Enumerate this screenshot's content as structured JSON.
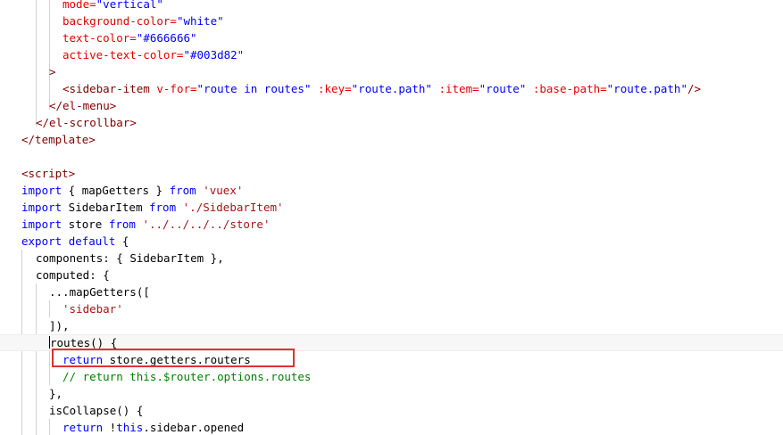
{
  "colors": {
    "tag": "#800000",
    "attribute": "#e50000",
    "string": "#0000ff",
    "keyword": "#0000ff",
    "js_string": "#a31515",
    "comment": "#008000",
    "plain": "#000000",
    "highlight_box": "#e03131"
  },
  "lines": [
    {
      "id": "l01",
      "tokens": [
        {
          "text": "mode=",
          "kind": "attribute"
        },
        {
          "text": "\"vertical\"",
          "kind": "string"
        }
      ]
    },
    {
      "id": "l02",
      "tokens": [
        {
          "text": "background-color=",
          "kind": "attribute"
        },
        {
          "text": "\"white\"",
          "kind": "string"
        }
      ]
    },
    {
      "id": "l03",
      "tokens": [
        {
          "text": "text-color=",
          "kind": "attribute"
        },
        {
          "text": "\"#666666\"",
          "kind": "string"
        }
      ]
    },
    {
      "id": "l04",
      "tokens": [
        {
          "text": "active-text-color=",
          "kind": "attribute"
        },
        {
          "text": "\"#003d82\"",
          "kind": "string"
        }
      ]
    },
    {
      "id": "l05",
      "tokens": [
        {
          "text": ">",
          "kind": "tag"
        }
      ]
    },
    {
      "id": "l06",
      "tokens": [
        {
          "text": "<sidebar-item",
          "kind": "tag"
        },
        {
          "text": " ",
          "kind": "plain"
        },
        {
          "text": "v-for=",
          "kind": "attribute"
        },
        {
          "text": "\"route in routes\"",
          "kind": "string"
        },
        {
          "text": " ",
          "kind": "plain"
        },
        {
          "text": ":key=",
          "kind": "attribute"
        },
        {
          "text": "\"route.path\"",
          "kind": "string"
        },
        {
          "text": " ",
          "kind": "plain"
        },
        {
          "text": ":item=",
          "kind": "attribute"
        },
        {
          "text": "\"route\"",
          "kind": "string"
        },
        {
          "text": " ",
          "kind": "plain"
        },
        {
          "text": ":base-path=",
          "kind": "attribute"
        },
        {
          "text": "\"route.path\"",
          "kind": "string"
        },
        {
          "text": "/>",
          "kind": "tag"
        }
      ]
    },
    {
      "id": "l07",
      "tokens": [
        {
          "text": "</el-menu>",
          "kind": "tag"
        }
      ]
    },
    {
      "id": "l08",
      "tokens": [
        {
          "text": "</el-scrollbar>",
          "kind": "tag"
        }
      ]
    },
    {
      "id": "l09",
      "tokens": [
        {
          "text": "</template>",
          "kind": "tag"
        }
      ]
    },
    {
      "id": "l10",
      "tokens": []
    },
    {
      "id": "l11",
      "tokens": [
        {
          "text": "<script>",
          "kind": "tag"
        }
      ]
    },
    {
      "id": "l12",
      "tokens": [
        {
          "text": "import",
          "kind": "keyword"
        },
        {
          "text": " { mapGetters } ",
          "kind": "plain"
        },
        {
          "text": "from",
          "kind": "keyword"
        },
        {
          "text": " ",
          "kind": "plain"
        },
        {
          "text": "'vuex'",
          "kind": "js_string"
        }
      ]
    },
    {
      "id": "l13",
      "tokens": [
        {
          "text": "import",
          "kind": "keyword"
        },
        {
          "text": " SidebarItem ",
          "kind": "plain"
        },
        {
          "text": "from",
          "kind": "keyword"
        },
        {
          "text": " ",
          "kind": "plain"
        },
        {
          "text": "'./SidebarItem'",
          "kind": "js_string"
        }
      ]
    },
    {
      "id": "l14",
      "tokens": [
        {
          "text": "import",
          "kind": "keyword"
        },
        {
          "text": " store ",
          "kind": "plain"
        },
        {
          "text": "from",
          "kind": "keyword"
        },
        {
          "text": " ",
          "kind": "plain"
        },
        {
          "text": "'../../../../store'",
          "kind": "js_string"
        }
      ]
    },
    {
      "id": "l15",
      "tokens": [
        {
          "text": "export",
          "kind": "keyword"
        },
        {
          "text": " ",
          "kind": "plain"
        },
        {
          "text": "default",
          "kind": "keyword"
        },
        {
          "text": " {",
          "kind": "plain"
        }
      ]
    },
    {
      "id": "l16",
      "tokens": [
        {
          "text": "components: { SidebarItem },",
          "kind": "plain"
        }
      ]
    },
    {
      "id": "l17",
      "tokens": [
        {
          "text": "computed: {",
          "kind": "plain"
        }
      ]
    },
    {
      "id": "l18",
      "tokens": [
        {
          "text": "...mapGetters([",
          "kind": "plain"
        }
      ]
    },
    {
      "id": "l19",
      "tokens": [
        {
          "text": "'sidebar'",
          "kind": "js_string"
        }
      ]
    },
    {
      "id": "l20",
      "tokens": [
        {
          "text": "]),",
          "kind": "plain"
        }
      ]
    },
    {
      "id": "l21",
      "tokens": [
        {
          "text": "routes() {",
          "kind": "plain"
        }
      ]
    },
    {
      "id": "l22",
      "tokens": [
        {
          "text": "return",
          "kind": "keyword"
        },
        {
          "text": " store.getters.routers",
          "kind": "plain"
        }
      ]
    },
    {
      "id": "l23",
      "tokens": [
        {
          "text": "// return this.$router.options.routes",
          "kind": "comment"
        }
      ]
    },
    {
      "id": "l24",
      "tokens": [
        {
          "text": "},",
          "kind": "plain"
        }
      ]
    },
    {
      "id": "l25",
      "tokens": [
        {
          "text": "isCollapse() {",
          "kind": "plain"
        }
      ]
    },
    {
      "id": "l26",
      "tokens": [
        {
          "text": "return",
          "kind": "keyword"
        },
        {
          "text": " !",
          "kind": "plain"
        },
        {
          "text": "this",
          "kind": "keyword"
        },
        {
          "text": ".sidebar.opened",
          "kind": "plain"
        }
      ]
    }
  ]
}
